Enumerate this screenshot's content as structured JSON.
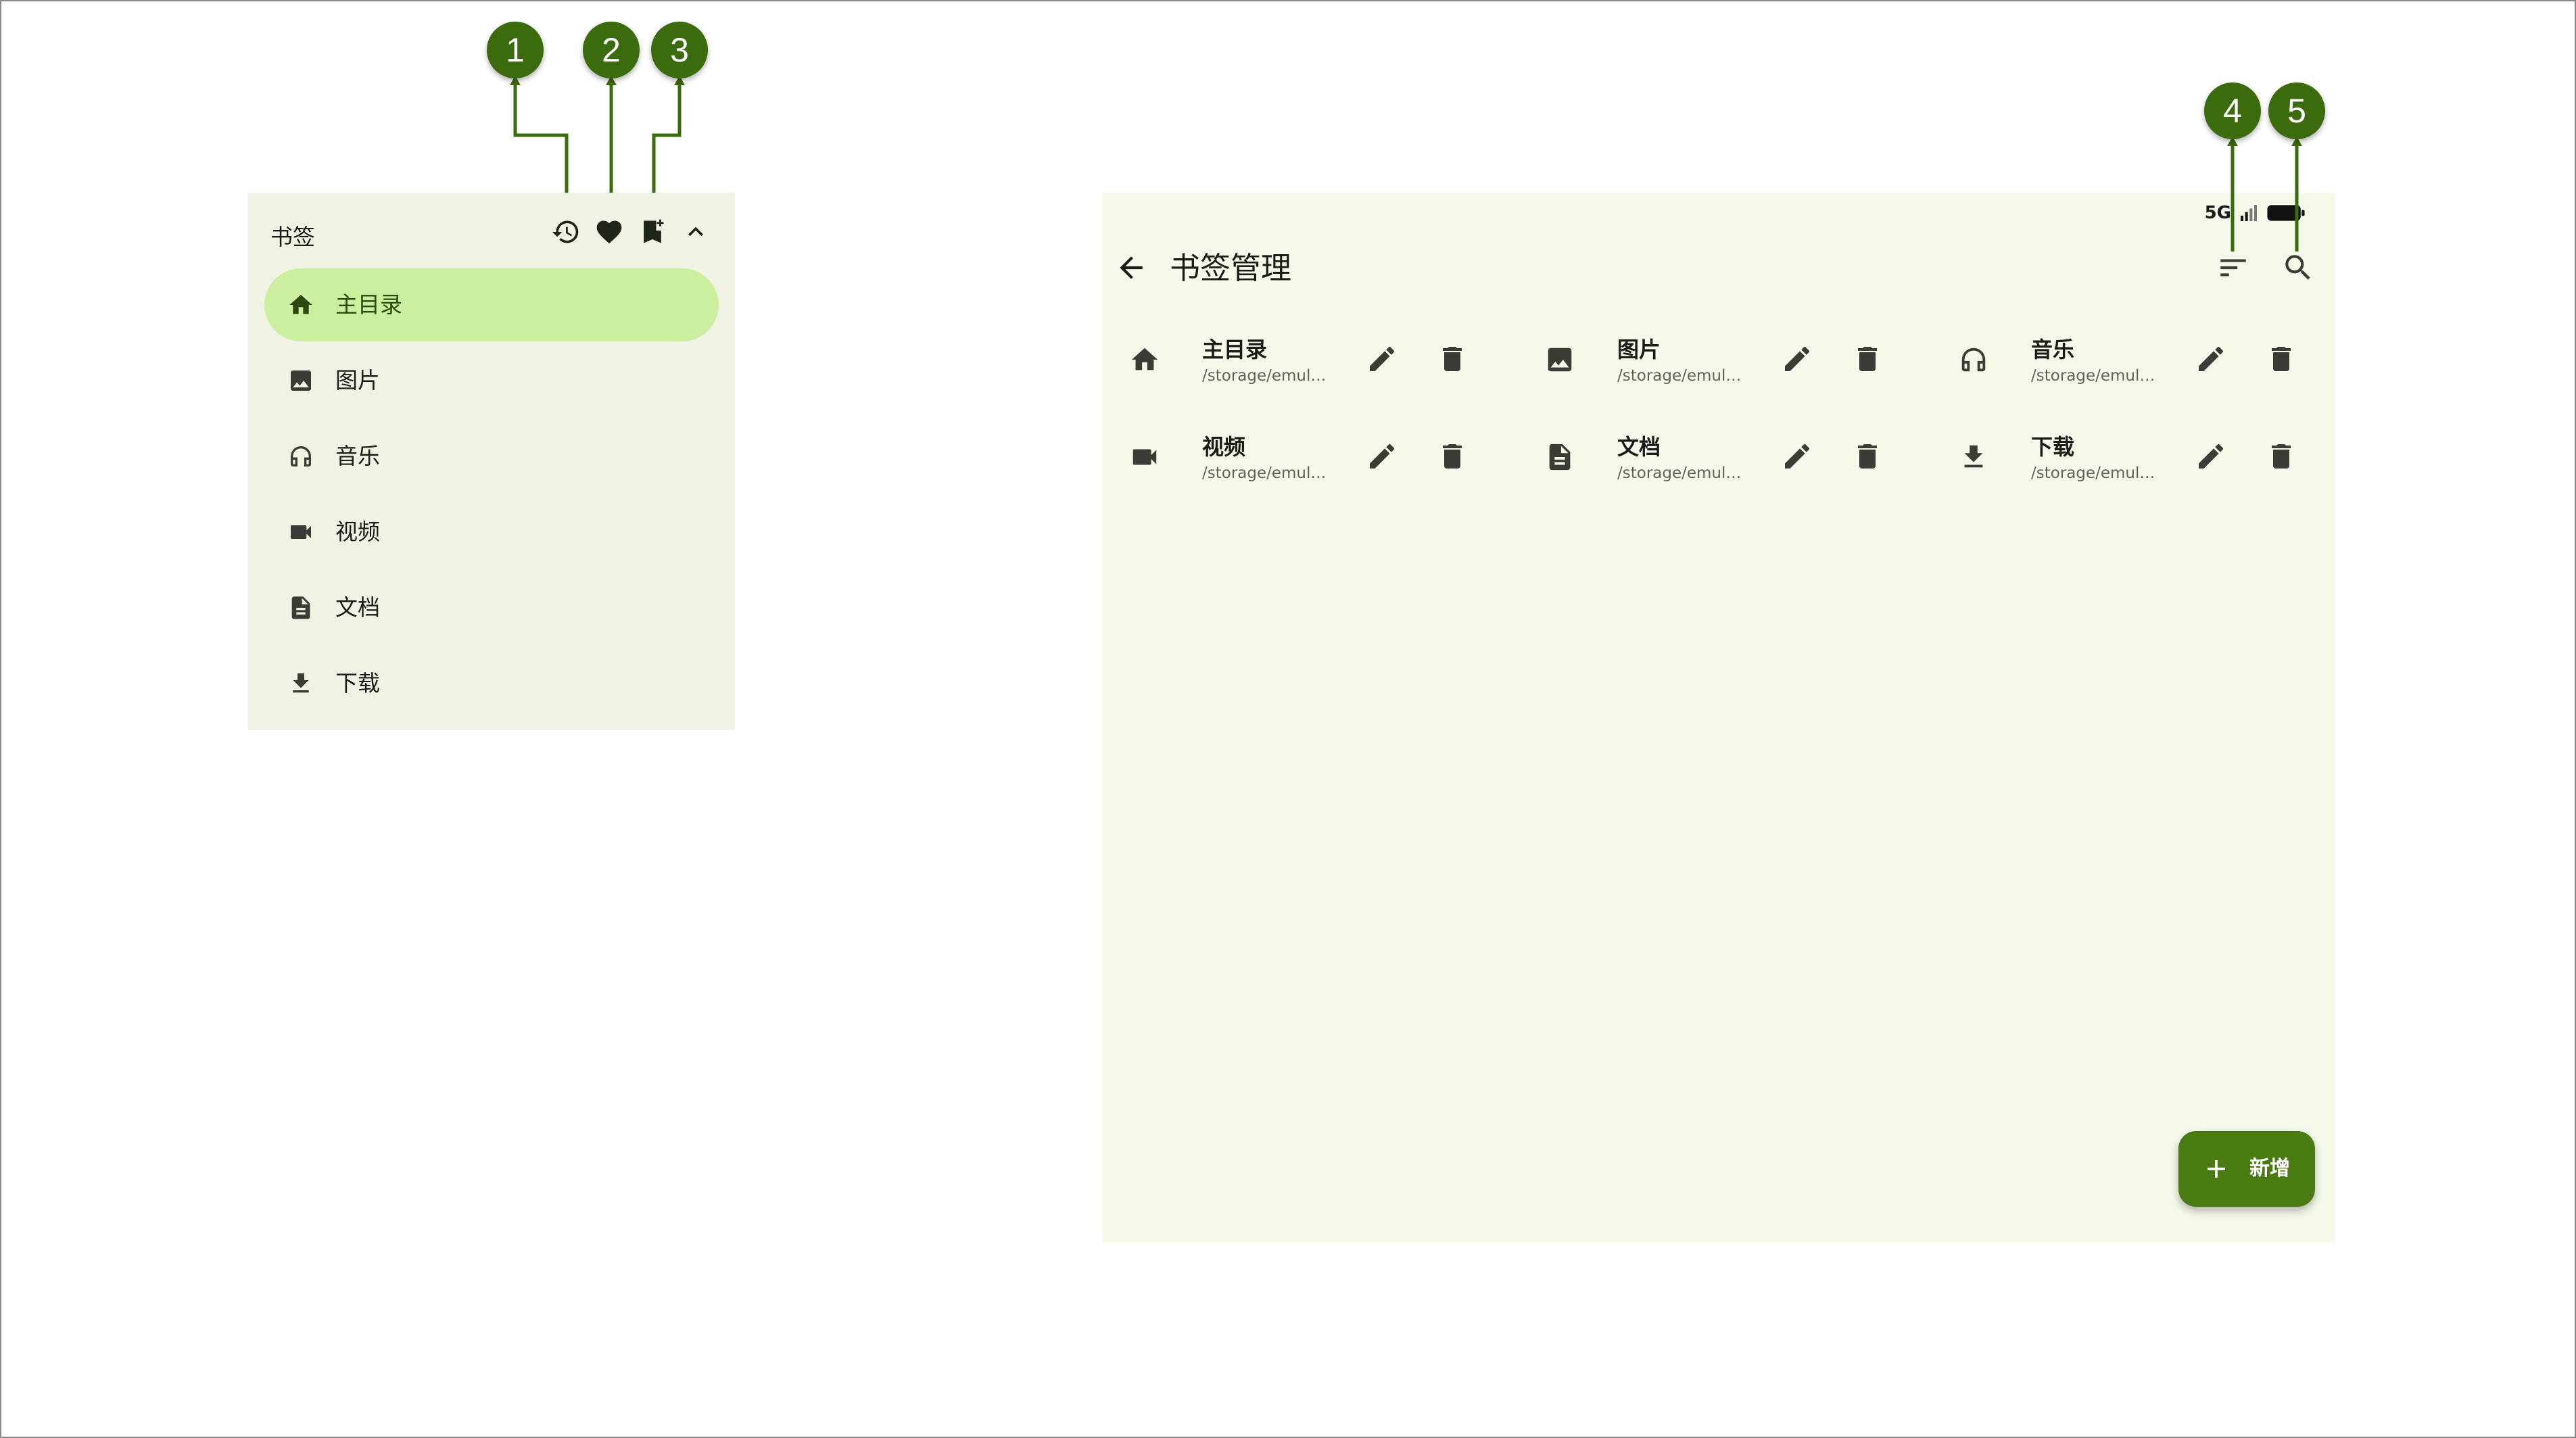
{
  "drawer": {
    "title": "书签",
    "actions": [
      {
        "icon": "history-icon"
      },
      {
        "icon": "heart-icon"
      },
      {
        "icon": "bookmark-add-icon"
      },
      {
        "icon": "chevron-up-icon"
      }
    ],
    "items": [
      {
        "label": "主目录",
        "icon": "home-icon",
        "active": true
      },
      {
        "label": "图片",
        "icon": "image-icon",
        "active": false
      },
      {
        "label": "音乐",
        "icon": "headphones-icon",
        "active": false
      },
      {
        "label": "视频",
        "icon": "videocam-icon",
        "active": false
      },
      {
        "label": "文档",
        "icon": "document-icon",
        "active": false
      },
      {
        "label": "下载",
        "icon": "download-icon",
        "active": false
      }
    ]
  },
  "app": {
    "status": {
      "network": "5G"
    },
    "title": "书签管理",
    "bookmarks": [
      {
        "name": "主目录",
        "path": "/storage/emul…",
        "icon": "home-icon"
      },
      {
        "name": "图片",
        "path": "/storage/emul…",
        "icon": "image-icon"
      },
      {
        "name": "音乐",
        "path": "/storage/emul…",
        "icon": "headphones-icon"
      },
      {
        "name": "视频",
        "path": "/storage/emul…",
        "icon": "videocam-icon"
      },
      {
        "name": "文档",
        "path": "/storage/emul…",
        "icon": "document-icon"
      },
      {
        "name": "下载",
        "path": "/storage/emul…",
        "icon": "download-icon"
      }
    ],
    "fab_label": "新增"
  },
  "callouts": [
    "1",
    "2",
    "3",
    "4",
    "5"
  ],
  "colors": {
    "accent": "#3b6b0c",
    "fab": "#4a7b12",
    "active_item": "#cbee9f",
    "drawer_bg": "#f0f3e4",
    "app_bg": "#f5f9ea",
    "icon": "#3a3d35"
  }
}
